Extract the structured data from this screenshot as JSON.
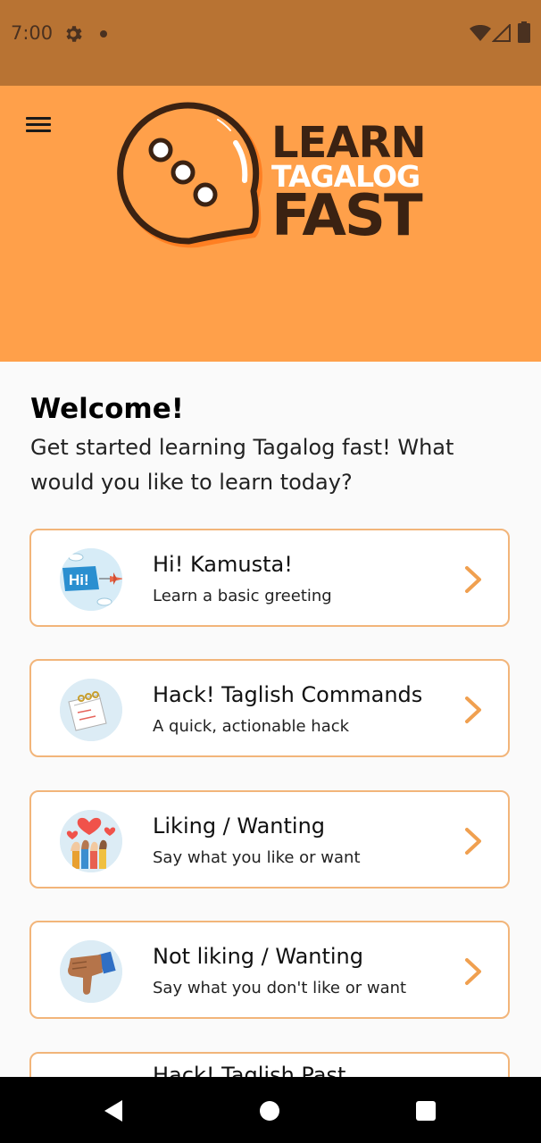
{
  "status_bar": {
    "time": "7:00",
    "icons": [
      "gear-icon",
      "notification-dot-icon",
      "wifi-icon",
      "signal-icon",
      "battery-icon"
    ],
    "background": "#b87333"
  },
  "header": {
    "background": "#ffa04a",
    "logo": {
      "line1": "LEARN",
      "line2": "TAGALOG",
      "line3": "FAST"
    },
    "menu_icon": "hamburger-menu-icon"
  },
  "welcome": {
    "title": "Welcome!",
    "subtitle": "Get started learning Tagalog fast! What would you like to learn today?"
  },
  "lessons": [
    {
      "title": "Hi! Kamusta!",
      "subtitle": "Learn a basic greeting",
      "icon": "hi-banner-plane-icon"
    },
    {
      "title": "Hack! Taglish Commands",
      "subtitle": "A quick, actionable hack",
      "icon": "notepad-icon"
    },
    {
      "title": "Liking / Wanting",
      "subtitle": "Say what you like or want",
      "icon": "raised-hands-hearts-icon"
    },
    {
      "title": "Not liking / Wanting",
      "subtitle": "Say what you don't like or want",
      "icon": "thumbs-down-icon"
    },
    {
      "title": "Hack! Taglish Past",
      "subtitle": "",
      "icon": ""
    }
  ],
  "colors": {
    "card_border": "#f2b57a",
    "chevron": "#f0a050",
    "accent_orange": "#ffa04a",
    "brown": "#3b2212"
  },
  "nav_bar": {
    "icons": [
      "back-icon",
      "home-icon",
      "recent-apps-icon"
    ]
  }
}
